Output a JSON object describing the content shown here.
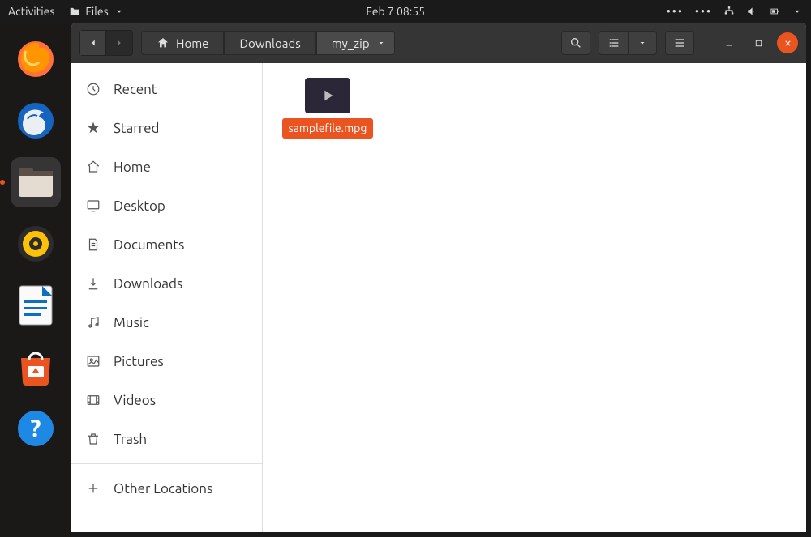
{
  "topbar": {
    "activities": "Activities",
    "app_menu": "Files",
    "datetime": "Feb 7  08:55"
  },
  "breadcrumb": {
    "home": "Home",
    "path": [
      "Downloads",
      "my_zip"
    ]
  },
  "sidebar": {
    "items": [
      {
        "icon": "clock",
        "label": "Recent"
      },
      {
        "icon": "star",
        "label": "Starred"
      },
      {
        "icon": "home",
        "label": "Home"
      },
      {
        "icon": "desktop",
        "label": "Desktop"
      },
      {
        "icon": "document",
        "label": "Documents"
      },
      {
        "icon": "download",
        "label": "Downloads"
      },
      {
        "icon": "music",
        "label": "Music"
      },
      {
        "icon": "picture",
        "label": "Pictures"
      },
      {
        "icon": "video",
        "label": "Videos"
      },
      {
        "icon": "trash",
        "label": "Trash"
      }
    ],
    "other": "Other Locations"
  },
  "files": [
    {
      "name": "samplefile.mpg",
      "type": "video",
      "selected": true
    }
  ]
}
